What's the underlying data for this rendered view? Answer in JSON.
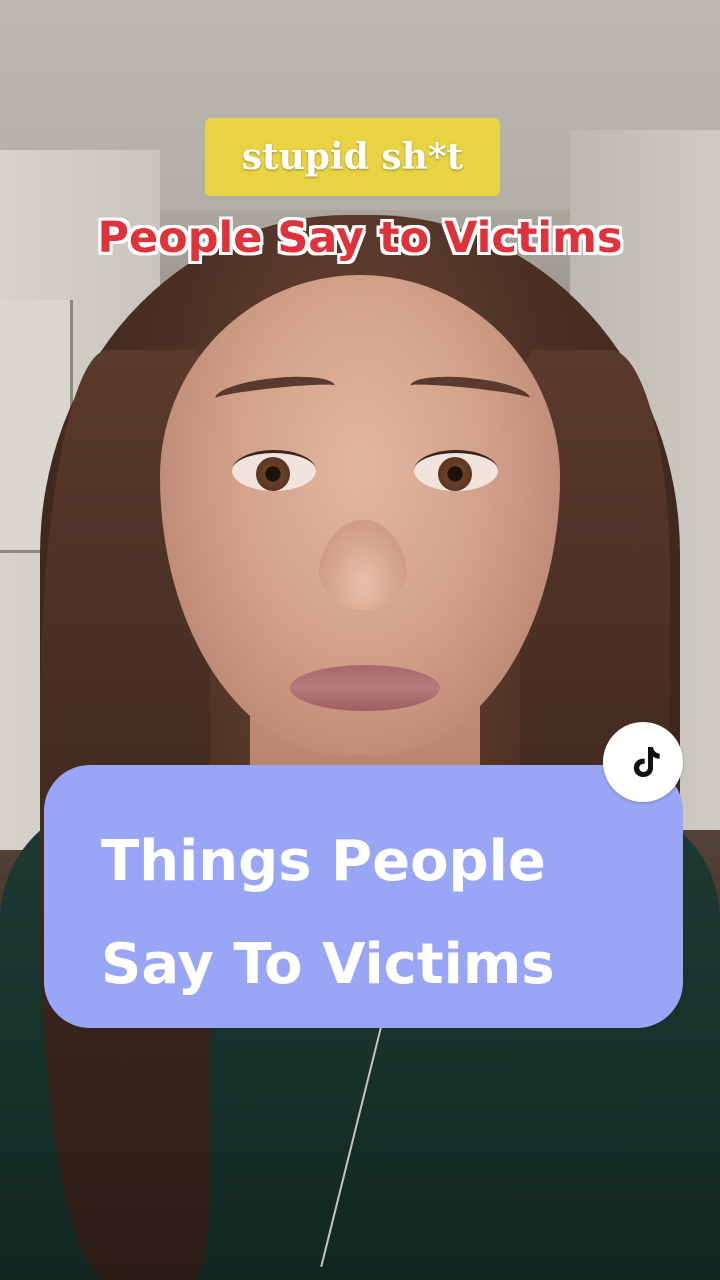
{
  "overlay": {
    "top_label": "stupid sh*t",
    "subtitle": "People Say to Victims"
  },
  "caption_card": {
    "lines": [
      "Things People",
      "Say To Victims"
    ]
  },
  "badge": {
    "icon": "tiktok-logo-icon"
  },
  "colors": {
    "top_label_bg": "#e8d342",
    "subtitle_text": "#e0323b",
    "caption_card_bg": "#98a6f5"
  }
}
